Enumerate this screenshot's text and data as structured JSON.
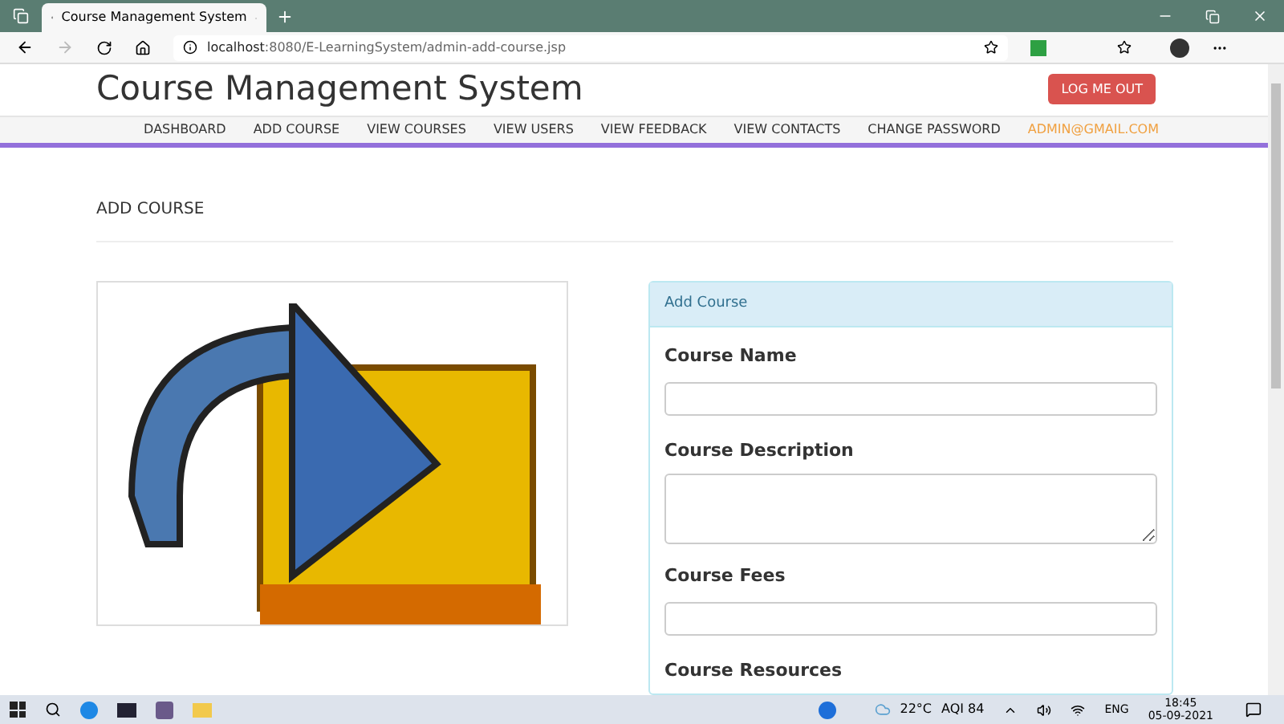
{
  "browser": {
    "tab_title": "Course Management System",
    "url_host": "localhost",
    "url_rest": ":8080/E-LearningSystem/admin-add-course.jsp"
  },
  "header": {
    "title": "Course Management System",
    "logout": "LOG ME OUT"
  },
  "nav": [
    {
      "label": "DASHBOARD",
      "selected": false
    },
    {
      "label": "ADD COURSE",
      "selected": false
    },
    {
      "label": "VIEW COURSES",
      "selected": false
    },
    {
      "label": "VIEW USERS",
      "selected": false
    },
    {
      "label": "VIEW FEEDBACK",
      "selected": false
    },
    {
      "label": "VIEW CONTACTS",
      "selected": false
    },
    {
      "label": "CHANGE PASSWORD",
      "selected": false
    },
    {
      "label": "ADMIN@GMAIL.COM",
      "selected": true
    }
  ],
  "page_heading": "ADD COURSE",
  "form": {
    "title": "Add Course",
    "fields": [
      {
        "label": "Course Name",
        "kind": "input"
      },
      {
        "label": "Course Description",
        "kind": "textarea"
      },
      {
        "label": "Course Fees",
        "kind": "input"
      },
      {
        "label": "Course Resources",
        "kind": "label"
      }
    ]
  },
  "taskbar": {
    "weather": "22°C",
    "aqi": "AQI 84",
    "lang": "ENG",
    "time": "18:45",
    "date": "05-09-2021"
  }
}
